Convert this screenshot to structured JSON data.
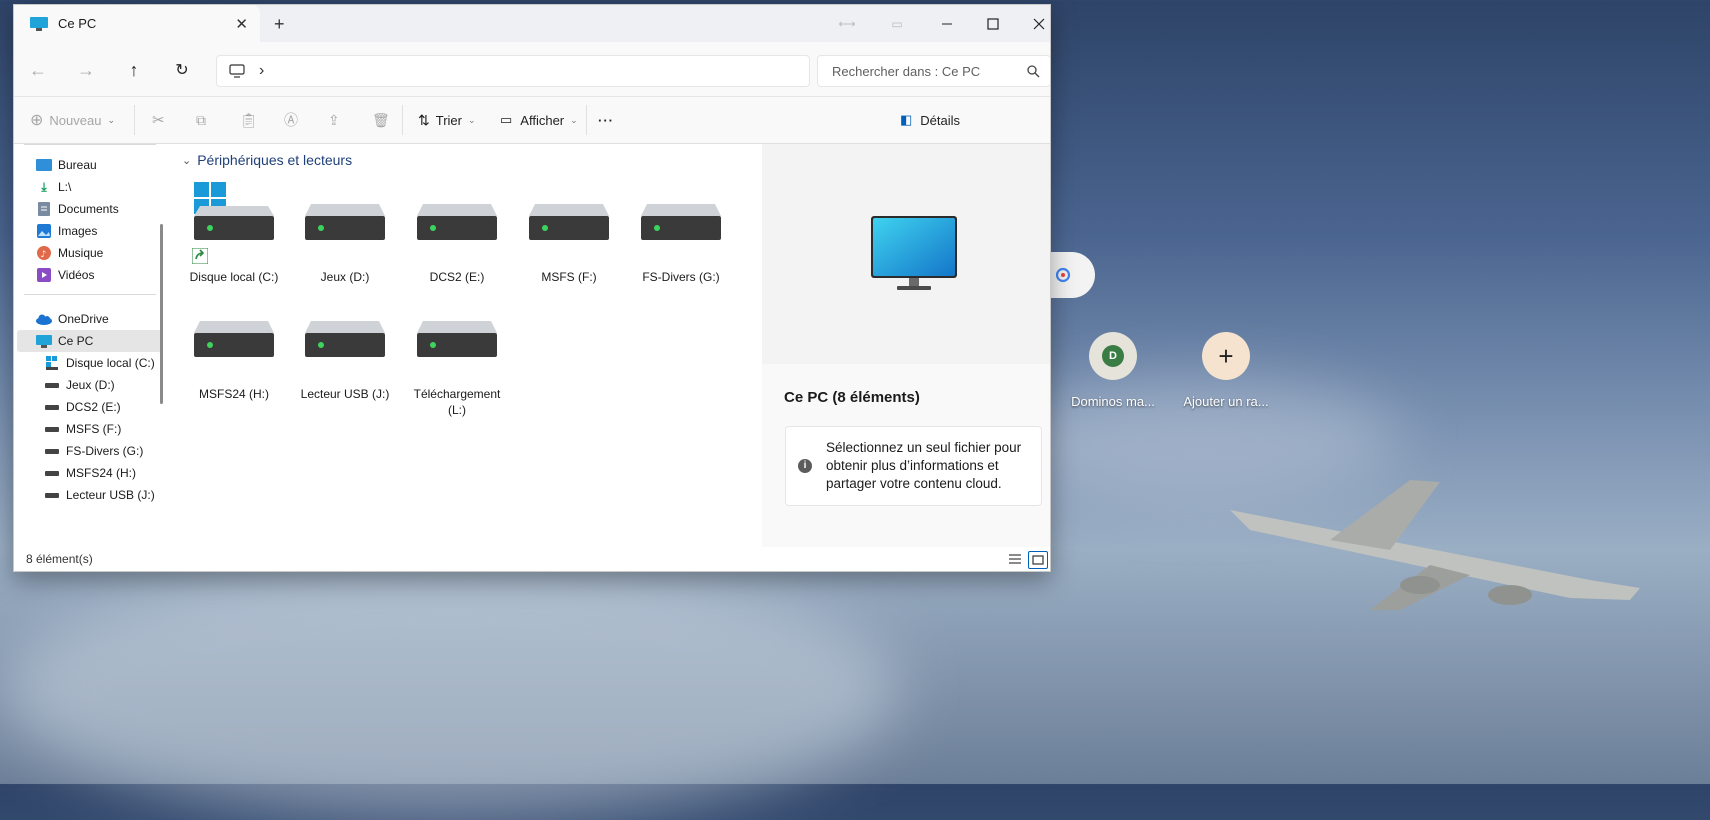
{
  "window": {
    "tab_title": "Ce PC",
    "new_tab_label": "+",
    "colors": {
      "accent": "#005fb8",
      "tab_bg": "#f9f9f9",
      "titlebar_bg": "#eef0f3"
    }
  },
  "nav": {
    "address_chevron": "›",
    "search_placeholder": "Rechercher dans : Ce PC"
  },
  "toolbar": {
    "new_label": "Nouveau",
    "sort_label": "Trier",
    "view_label": "Afficher",
    "more_label": "···",
    "details_label": "Détails"
  },
  "sidebar": {
    "quick": [
      {
        "label": "Bureau",
        "icon": "desktop-icon"
      },
      {
        "label": "L:\\",
        "icon": "download-icon"
      },
      {
        "label": "Documents",
        "icon": "document-icon"
      },
      {
        "label": "Images",
        "icon": "image-icon"
      },
      {
        "label": "Musique",
        "icon": "music-icon"
      },
      {
        "label": "Vidéos",
        "icon": "video-icon"
      }
    ],
    "onedrive": "OneDrive",
    "this_pc": "Ce PC",
    "drives": [
      "Disque local (C:)",
      "Jeux (D:)",
      "DCS2 (E:)",
      "MSFS (F:)",
      "FS-Divers (G:)",
      "MSFS24 (H:)",
      "Lecteur USB (J:)"
    ]
  },
  "main": {
    "group_title": "Périphériques et lecteurs",
    "drives": [
      "Disque local (C:)",
      "Jeux (D:)",
      "DCS2 (E:)",
      "MSFS (F:)",
      "FS-Divers (G:)",
      "MSFS24 (H:)",
      "Lecteur USB (J:)",
      "Téléchargement (L:)"
    ]
  },
  "details": {
    "title": "Ce PC (8 éléments)",
    "info_symbol": "i",
    "message": "Sélectionnez un seul fichier pour obtenir plus d’informations et partager votre contenu cloud."
  },
  "status": {
    "count": "8 élément(s)"
  },
  "desktop": {
    "shortcuts": [
      {
        "label": "Dominos ma...",
        "initial": "D",
        "color": "#3a7d44",
        "bg": "#e5e3da"
      },
      {
        "label": "Ajouter un ra...",
        "initial": "+",
        "color": "#222",
        "bg": "#f6e3cf"
      }
    ]
  }
}
